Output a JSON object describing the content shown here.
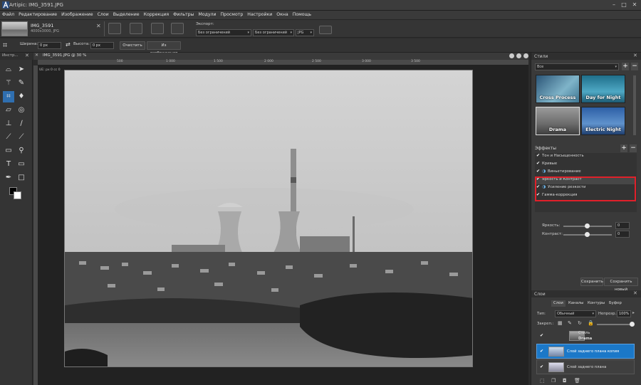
{
  "app": {
    "title": "Artipic: IMG_3591.JPG"
  },
  "menu": [
    "Файл",
    "Редактирование",
    "Изображение",
    "Слои",
    "Выделение",
    "Коррекция",
    "Фильтры",
    "Модули",
    "Просмотр",
    "Настройки",
    "Окна",
    "Помощь"
  ],
  "file": {
    "name": "IMG_3591",
    "info": "4000x3000, JPG"
  },
  "export": {
    "label": "Экспорт:",
    "width_select": "Без ограничений",
    "height_select": "Без ограничений",
    "format_select": "JPG"
  },
  "options": {
    "width_label": "Ширина:",
    "width_value": "0 px",
    "height_label": "Высота:",
    "height_value": "0 px",
    "clear_button": "Очистить",
    "from_image_button": "Из изображения"
  },
  "tools_panel": {
    "title": "Инстр..."
  },
  "document": {
    "tab_title": "IMG_3591.JPG @ 30 %",
    "ruler_marks": [
      "500",
      "1 000",
      "1 500",
      "2 000",
      "2 500",
      "3 000",
      "3 500"
    ],
    "status_text": "UE: px 0 cc 0"
  },
  "styles_panel": {
    "title": "Стили",
    "filter_value": "Все",
    "presets": [
      "Cross Process",
      "Day for Night",
      "Drama",
      "Electric Night"
    ]
  },
  "effects": {
    "title": "Эффекты",
    "items": [
      "Тон и Насыщенность",
      "Кривые",
      "Виньетирование",
      "Яркость и Контраст",
      "Усиление резкости",
      "Гамма-коррекция"
    ],
    "brightness_label": "Яркость:",
    "brightness_value": "0",
    "contrast_label": "Контраст:",
    "contrast_value": "0",
    "save_button": "Сохранить",
    "save_new_button": "Сохранить новый"
  },
  "layers_panel": {
    "title": "Слои",
    "tabs": [
      "Слои",
      "Каналы",
      "Контуры",
      "Буфер"
    ],
    "type_label": "Тип:",
    "blend_mode": "Обычный",
    "opacity_label": "Непрозр.:",
    "opacity_value": "100%",
    "lock_label": "Закреп.:",
    "layers": [
      {
        "name": "Стиль",
        "sub": "Drama"
      },
      {
        "name": "Слой заднего плана копия"
      },
      {
        "name": "Слой заднего плана"
      }
    ]
  },
  "colors": {
    "accent": "#2f6fb0",
    "selection": "#1b78c8",
    "highlight_box": "#e0202a"
  }
}
